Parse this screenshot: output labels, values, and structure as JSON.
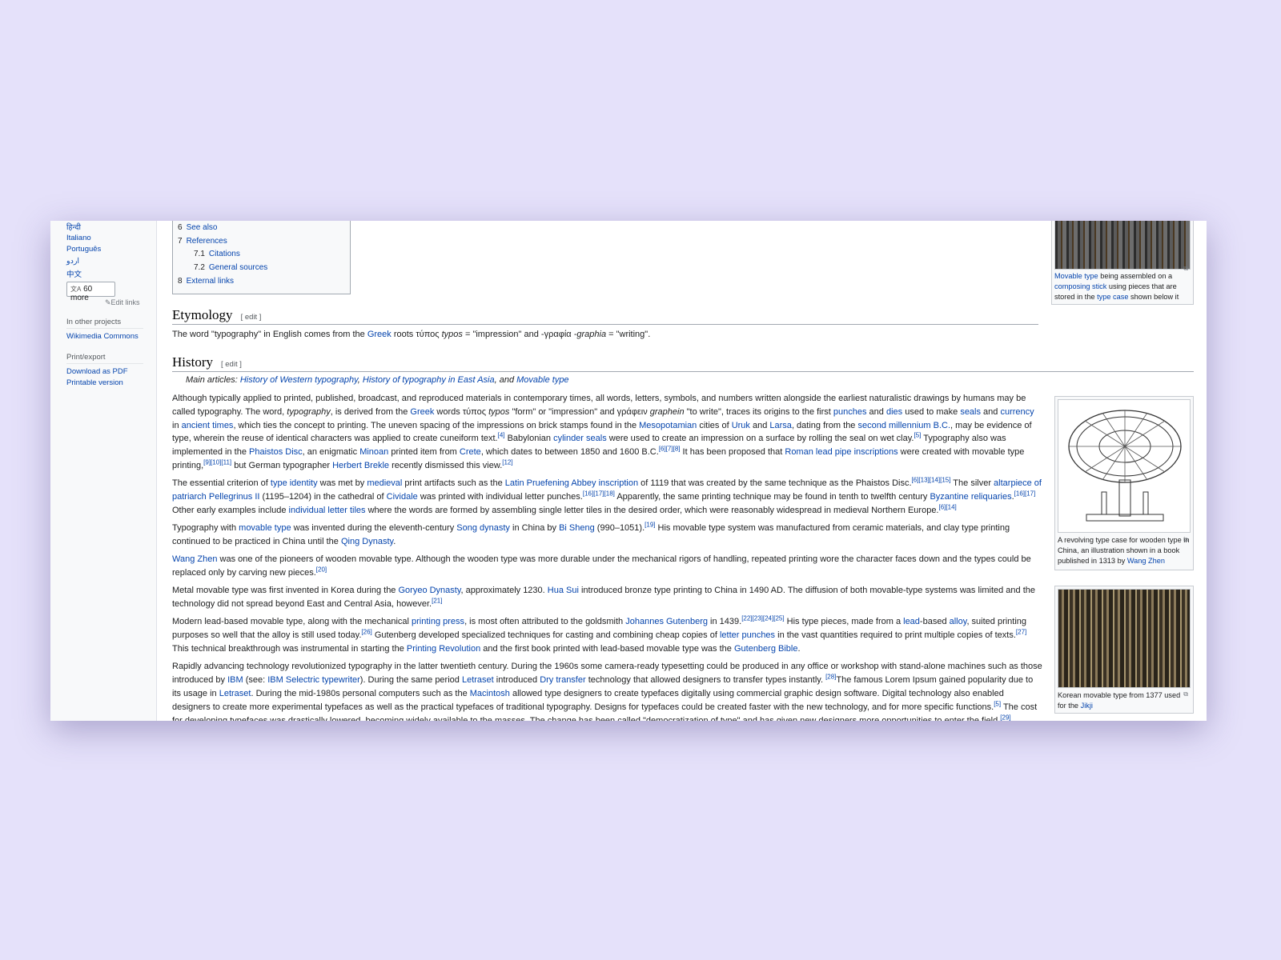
{
  "sidebar": {
    "languages": [
      "हिन्दी",
      "Italiano",
      "Português",
      "اردو",
      "中文"
    ],
    "more_label": "60 more",
    "more_icon": "translate-icon",
    "edit_links": "Edit links",
    "other_projects_heading": "In other projects",
    "wikimedia_commons": "Wikimedia Commons",
    "print_heading": "Print/export",
    "download_pdf": "Download as PDF",
    "printable_version": "Printable version"
  },
  "toc": [
    {
      "num": "6",
      "label": "See also",
      "level": 1
    },
    {
      "num": "7",
      "label": "References",
      "level": 1
    },
    {
      "num": "7.1",
      "label": "Citations",
      "level": 2
    },
    {
      "num": "7.2",
      "label": "General sources",
      "level": 2
    },
    {
      "num": "8",
      "label": "External links",
      "level": 1
    }
  ],
  "etymology": {
    "heading": "Etymology",
    "edit": "[ edit ]",
    "text": [
      {
        "t": "The word \"typography\" in English comes from the "
      },
      {
        "t": "Greek",
        "a": 1
      },
      {
        "t": " roots τύπος "
      },
      {
        "t": "typos",
        "i": 1
      },
      {
        "t": " = \"impression\" and -γραφία "
      },
      {
        "t": "-graphia",
        "i": 1
      },
      {
        "t": " = \"writing\"."
      }
    ]
  },
  "history": {
    "heading": "History",
    "edit": "[ edit ]",
    "main_articles": [
      {
        "t": "Main articles: "
      },
      {
        "t": "History of Western typography",
        "a": 1
      },
      {
        "t": ", "
      },
      {
        "t": "History of typography in East Asia",
        "a": 1
      },
      {
        "t": ", and "
      },
      {
        "t": "Movable type",
        "a": 1
      }
    ],
    "paragraphs": [
      [
        {
          "t": "Although typically applied to printed, published, broadcast, and reproduced materials in contemporary times, all words, letters, symbols, and numbers written alongside the earliest naturalistic drawings by humans may be called typography. The word, "
        },
        {
          "t": "typography",
          "i": 1
        },
        {
          "t": ", is derived from the "
        },
        {
          "t": "Greek",
          "a": 1
        },
        {
          "t": " words τύπος "
        },
        {
          "t": "typos",
          "i": 1
        },
        {
          "t": " \"form\" or \"impression\" and γράφειν "
        },
        {
          "t": "graphein",
          "i": 1
        },
        {
          "t": " \"to write\", traces its origins to the first "
        },
        {
          "t": "punches",
          "a": 1
        },
        {
          "t": " and "
        },
        {
          "t": "dies",
          "a": 1
        },
        {
          "t": " used to make "
        },
        {
          "t": "seals",
          "a": 1
        },
        {
          "t": " and "
        },
        {
          "t": "currency",
          "a": 1
        },
        {
          "t": " in "
        },
        {
          "t": "ancient times",
          "a": 1
        },
        {
          "t": ", which ties the concept to printing. The uneven spacing of the impressions on brick stamps found in the "
        },
        {
          "t": "Mesopotamian",
          "a": 1
        },
        {
          "t": " cities of "
        },
        {
          "t": "Uruk",
          "a": 1
        },
        {
          "t": " and "
        },
        {
          "t": "Larsa",
          "a": 1
        },
        {
          "t": ", dating from the "
        },
        {
          "t": "second millennium B.C.",
          "a": 1
        },
        {
          "t": ", may be evidence of type, wherein the reuse of identical characters was applied to create cuneiform text."
        },
        {
          "t": "[4]",
          "s": 1
        },
        {
          "t": " Babylonian "
        },
        {
          "t": "cylinder seals",
          "a": 1
        },
        {
          "t": " were used to create an impression on a surface by rolling the seal on wet clay."
        },
        {
          "t": "[5]",
          "s": 1
        },
        {
          "t": " Typography also was implemented in the "
        },
        {
          "t": "Phaistos Disc",
          "a": 1
        },
        {
          "t": ", an enigmatic "
        },
        {
          "t": "Minoan",
          "a": 1
        },
        {
          "t": " printed item from "
        },
        {
          "t": "Crete",
          "a": 1
        },
        {
          "t": ", which dates to between 1850 and 1600 B.C."
        },
        {
          "t": "[6][7][8]",
          "s": 1
        },
        {
          "t": " It has been proposed that "
        },
        {
          "t": "Roman lead pipe inscriptions",
          "a": 1
        },
        {
          "t": " were created with movable type printing,"
        },
        {
          "t": "[9][10][11]",
          "s": 1
        },
        {
          "t": " but German typographer "
        },
        {
          "t": "Herbert Brekle",
          "a": 1
        },
        {
          "t": " recently dismissed this view."
        },
        {
          "t": "[12]",
          "s": 1
        }
      ],
      [
        {
          "t": "The essential criterion of "
        },
        {
          "t": "type identity",
          "a": 1
        },
        {
          "t": " was met by "
        },
        {
          "t": "medieval",
          "a": 1
        },
        {
          "t": " print artifacts such as the "
        },
        {
          "t": "Latin Pruefening Abbey inscription",
          "a": 1
        },
        {
          "t": " of 1119 that was created by the same technique as the Phaistos Disc."
        },
        {
          "t": "[6][13][14][15]",
          "s": 1
        },
        {
          "t": " The silver "
        },
        {
          "t": "altarpiece of patriarch Pellegrinus II",
          "a": 1
        },
        {
          "t": " (1195–1204) in the cathedral of "
        },
        {
          "t": "Cividale",
          "a": 1
        },
        {
          "t": " was printed with individual letter punches."
        },
        {
          "t": "[16][17][18]",
          "s": 1
        },
        {
          "t": " Apparently, the same printing technique may be found in tenth to twelfth century "
        },
        {
          "t": "Byzantine reliquaries",
          "a": 1
        },
        {
          "t": "."
        },
        {
          "t": "[16][17]",
          "s": 1
        },
        {
          "t": " Other early examples include "
        },
        {
          "t": "individual letter tiles",
          "a": 1
        },
        {
          "t": " where the words are formed by assembling single letter tiles in the desired order, which were reasonably widespread in medieval Northern Europe."
        },
        {
          "t": "[6][14]",
          "s": 1
        }
      ],
      [
        {
          "t": "Typography with "
        },
        {
          "t": "movable type",
          "a": 1
        },
        {
          "t": " was invented during the eleventh-century "
        },
        {
          "t": "Song dynasty",
          "a": 1
        },
        {
          "t": " in China by "
        },
        {
          "t": "Bi Sheng",
          "a": 1
        },
        {
          "t": " (990–1051)."
        },
        {
          "t": "[19]",
          "s": 1
        },
        {
          "t": " His movable type system was manufactured from ceramic materials, and clay type printing continued to be practiced in China until the "
        },
        {
          "t": "Qing Dynasty",
          "a": 1
        },
        {
          "t": "."
        }
      ],
      [
        {
          "t": "Wang Zhen",
          "a": 1
        },
        {
          "t": " was one of the pioneers of wooden movable type. Although the wooden type was more durable under the mechanical rigors of handling, repeated printing wore the character faces down and the types could be replaced only by carving new pieces."
        },
        {
          "t": "[20]",
          "s": 1
        }
      ],
      [
        {
          "t": "Metal movable type was first invented in Korea during the "
        },
        {
          "t": "Goryeo Dynasty",
          "a": 1
        },
        {
          "t": ", approximately 1230. "
        },
        {
          "t": "Hua Sui",
          "a": 1
        },
        {
          "t": " introduced bronze type printing to China in 1490 AD. The diffusion of both movable-type systems was limited and the technology did not spread beyond East and Central Asia, however."
        },
        {
          "t": "[21]",
          "s": 1
        }
      ],
      [
        {
          "t": "Modern lead-based movable type, along with the mechanical "
        },
        {
          "t": "printing press",
          "a": 1
        },
        {
          "t": ", is most often attributed to the goldsmith "
        },
        {
          "t": "Johannes Gutenberg",
          "a": 1
        },
        {
          "t": " in 1439."
        },
        {
          "t": "[22][23][24][25]",
          "s": 1
        },
        {
          "t": " His type pieces, made from a "
        },
        {
          "t": "lead",
          "a": 1
        },
        {
          "t": "-based "
        },
        {
          "t": "alloy",
          "a": 1
        },
        {
          "t": ", suited printing purposes so well that the alloy is still used today."
        },
        {
          "t": "[26]",
          "s": 1
        },
        {
          "t": " Gutenberg developed specialized techniques for casting and combining cheap copies of "
        },
        {
          "t": "letter punches",
          "a": 1
        },
        {
          "t": " in the vast quantities required to print multiple copies of texts."
        },
        {
          "t": "[27]",
          "s": 1
        },
        {
          "t": " This technical breakthrough was instrumental in starting the "
        },
        {
          "t": "Printing Revolution",
          "a": 1
        },
        {
          "t": " and the first book printed with lead-based movable type was the "
        },
        {
          "t": "Gutenberg Bible",
          "a": 1
        },
        {
          "t": "."
        }
      ],
      [
        {
          "t": "Rapidly advancing technology revolutionized typography in the latter twentieth century. During the 1960s some camera-ready typesetting could be produced in any office or workshop with stand-alone machines such as those introduced by "
        },
        {
          "t": "IBM",
          "a": 1
        },
        {
          "t": " (see: "
        },
        {
          "t": "IBM Selectric typewriter",
          "a": 1
        },
        {
          "t": "). During the same period "
        },
        {
          "t": "Letraset",
          "a": 1
        },
        {
          "t": " introduced "
        },
        {
          "t": "Dry transfer",
          "a": 1
        },
        {
          "t": " technology that allowed designers to transfer types instantly. "
        },
        {
          "t": "[28]",
          "s": 1
        },
        {
          "t": "The famous Lorem Ipsum gained popularity due to its usage in "
        },
        {
          "t": "Letraset",
          "a": 1
        },
        {
          "t": ". During the mid-1980s personal computers such as the "
        },
        {
          "t": "Macintosh",
          "a": 1
        },
        {
          "t": " allowed type designers to create typefaces digitally using commercial graphic design software. Digital technology also enabled designers to create more experimental typefaces as well as the practical typefaces of traditional typography. Designs for typefaces could be created faster with the new technology, and for more specific functions."
        },
        {
          "t": "[5]",
          "s": 1
        },
        {
          "t": " The cost for developing typefaces was drastically lowered, becoming widely available to the masses. The change has been called \"democratization of type\" and has given new designers more opportunities to enter the field."
        },
        {
          "t": "[29]",
          "s": 1
        }
      ]
    ]
  },
  "figures": [
    {
      "caption": [
        {
          "t": "Movable type",
          "a": 1
        },
        {
          "t": " being assembled on a "
        },
        {
          "t": "composing stick",
          "a": 1
        },
        {
          "t": " using pieces that are stored in the "
        },
        {
          "t": "type case",
          "a": 1
        },
        {
          "t": " shown below it"
        }
      ]
    },
    {
      "caption": [
        {
          "t": "A revolving type case for wooden type in China, an illustration shown in a book published in 1313 by "
        },
        {
          "t": "Wang Zhen",
          "a": 1
        }
      ]
    },
    {
      "caption": [
        {
          "t": "Korean movable type from 1377 used for the "
        },
        {
          "t": "Jikji",
          "a": 1
        }
      ]
    }
  ],
  "colors": {
    "link": "#0645ad",
    "background": "#e5e1fa",
    "text": "#202122"
  }
}
